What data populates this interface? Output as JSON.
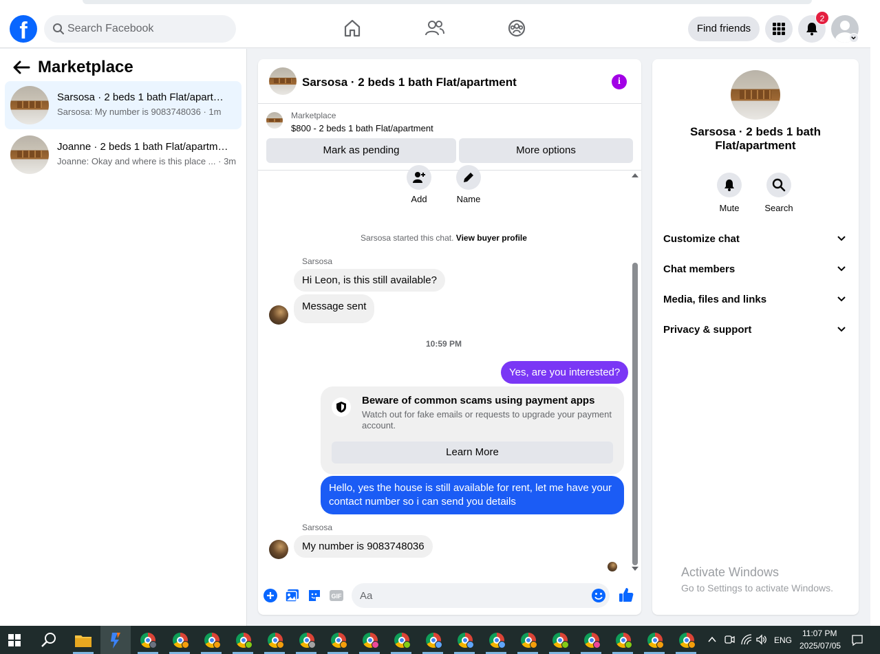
{
  "header": {
    "search_placeholder": "Search Facebook",
    "find_friends": "Find friends",
    "notification_count": "2",
    "logo": "f"
  },
  "sidebar": {
    "title": "Marketplace",
    "conversations": [
      {
        "title": "Sarsosa · 2 beds 1 bath Flat/apartment",
        "subtitle": "Sarsosa: My number is 9083748036 · 1m"
      },
      {
        "title": "Joanne · 2 beds 1 bath Flat/apartment",
        "subtitle": "Joanne: Okay and where is this place ... · 3m"
      }
    ]
  },
  "chat": {
    "title": "Sarsosa · 2 beds 1 bath Flat/apartment",
    "listing_label": "Marketplace",
    "listing_price": "$800 - 2 beds 1 bath Flat/apartment",
    "mark_pending": "Mark as pending",
    "more_options": "More options",
    "actions": {
      "add": "Add",
      "name": "Name"
    },
    "started_text": "Sarsosa started this chat.",
    "buyer_profile_link": "View buyer profile",
    "sender1": "Sarsosa",
    "msg1": "Hi Leon, is this still available?",
    "msg2": "Message sent",
    "timestamp": "10:59 PM",
    "msg3": "Yes, are you interested?",
    "scam_title": "Beware of common scams using payment apps",
    "scam_body": "Watch out for fake emails or requests to upgrade your payment account.",
    "learn_more": "Learn More",
    "msg4": "Hello, yes the house is still available for rent, let me have your contact number so i can send you details",
    "sender2": "Sarsosa",
    "msg5": "My number is 9083748036",
    "composer_placeholder": "Aa",
    "gif_label": "GIF",
    "colors": {
      "outgoing_purple": "#7a37f5",
      "outgoing_blue": "#1b5cf5",
      "info_purple": "#a200e6"
    }
  },
  "info_panel": {
    "title": "Sarsosa · 2 beds 1 bath Flat/apartment",
    "mute": "Mute",
    "search": "Search",
    "sections": [
      "Customize chat",
      "Chat members",
      "Media, files and links",
      "Privacy & support"
    ]
  },
  "watermark": {
    "title": "Activate Windows",
    "subtitle": "Go to Settings to activate Windows."
  },
  "taskbar": {
    "language": "ENG",
    "time": "11:07 PM",
    "date": "2025/07/05"
  }
}
